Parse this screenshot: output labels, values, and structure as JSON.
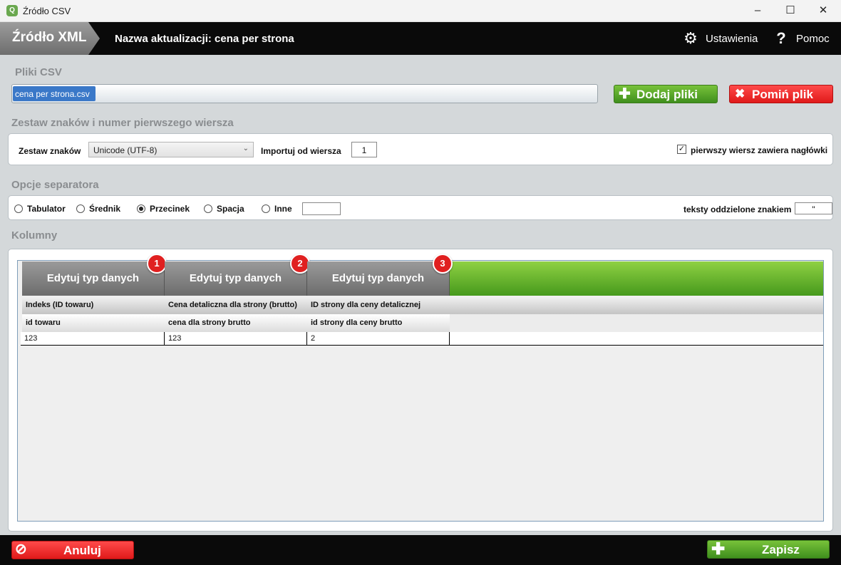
{
  "window": {
    "title": "Źródło CSV",
    "minimize": "–",
    "maximize": "☐",
    "close": "✕"
  },
  "header": {
    "brand": "Źródło XML",
    "update_title": "Nazwa aktualizacji: cena per strona",
    "settings_label": "Ustawienia",
    "help_label": "Pomoc"
  },
  "files": {
    "section_title": "Pliki CSV",
    "selected_file": "cena per strona.csv",
    "add_label": "Dodaj pliki",
    "skip_label": "Pomiń plik"
  },
  "charset": {
    "section_title": "Zestaw znaków i numer pierwszego wiersza",
    "charset_label": "Zestaw znaków",
    "charset_value": "Unicode (UTF-8)",
    "import_from_label": "Importuj od wiersza",
    "import_from_value": "1",
    "header_row_label": "pierwszy wiersz zawiera nagłówki",
    "header_row_checked": true
  },
  "separator": {
    "section_title": "Opcje separatora",
    "options": [
      {
        "label": "Tabulator",
        "selected": false
      },
      {
        "label": "Średnik",
        "selected": false
      },
      {
        "label": "Przecinek",
        "selected": true
      },
      {
        "label": "Spacja",
        "selected": false
      },
      {
        "label": "Inne",
        "selected": false
      }
    ],
    "other_value": "",
    "quote_label": "teksty oddzielone znakiem",
    "quote_value": "\""
  },
  "columns": {
    "section_title": "Kolumny",
    "items": [
      {
        "badge": "1",
        "edit_label": "Edytuj typ danych",
        "type": "Indeks (ID towaru)",
        "header": "id towaru",
        "value": "123"
      },
      {
        "badge": "2",
        "edit_label": "Edytuj typ danych",
        "type": "Cena detaliczna dla strony (brutto)",
        "header": "cena dla strony brutto",
        "value": "123"
      },
      {
        "badge": "3",
        "edit_label": "Edytuj typ danych",
        "type": "ID strony dla ceny detalicznej",
        "header": "id strony dla ceny brutto",
        "value": "2"
      }
    ]
  },
  "footer": {
    "cancel_label": "Anuluj",
    "save_label": "Zapisz"
  },
  "colors": {
    "accent_green": "#46991c",
    "danger_red": "#e01a1a",
    "header_black": "#0a0a0a"
  }
}
